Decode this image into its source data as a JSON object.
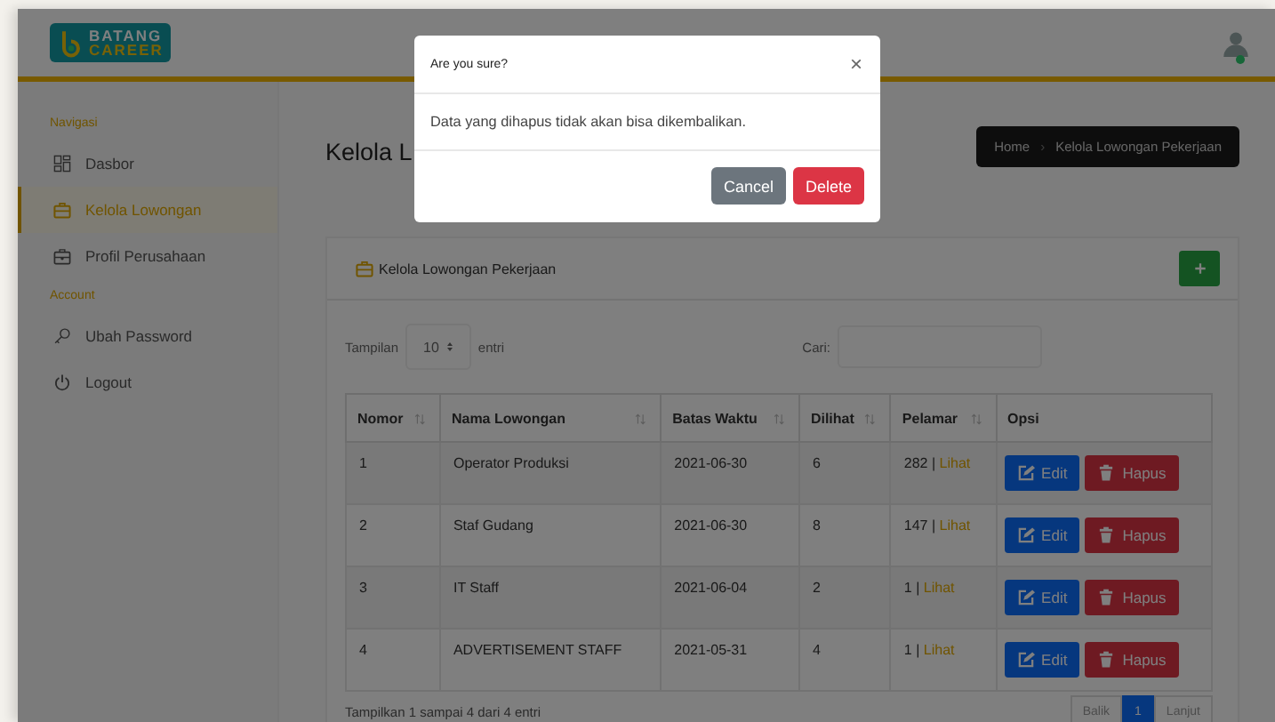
{
  "header": {
    "logo": {
      "line1": "BATANG",
      "line2": "CAREER"
    },
    "user": {
      "online": true
    }
  },
  "sidebar": {
    "sections": [
      {
        "heading": "Navigasi",
        "items": [
          {
            "label": "Dasbor",
            "selected": false
          },
          {
            "label": "Kelola Lowongan",
            "selected": true
          },
          {
            "label": "Profil Perusahaan",
            "selected": false
          }
        ]
      },
      {
        "heading": "Account",
        "items": [
          {
            "label": "Ubah Password",
            "selected": false
          },
          {
            "label": "Logout",
            "selected": false
          }
        ]
      }
    ]
  },
  "page_title": "Kelola L",
  "breadcrumb": {
    "items": [
      "Home",
      "Kelola Lowongan Pekerjaan"
    ],
    "separator": "›"
  },
  "card": {
    "title": "Kelola Lowongan Pekerjaan",
    "length_label": "Tampilan",
    "length_value": "10",
    "length_suffix": "entri",
    "search_label": "Cari:",
    "table": {
      "columns": [
        "Nomor",
        "Nama Lowongan",
        "Batas Waktu",
        "Dilihat",
        "Pelamar",
        "Opsi"
      ],
      "rows": [
        {
          "cells": [
            "1",
            "Operator Produksi",
            "2021-06-30",
            "6"
          ],
          "applicants": "282 |",
          "link": "Lihat",
          "actions": [
            "Edit",
            "Hapus"
          ]
        },
        {
          "cells": [
            "2",
            "Staf Gudang",
            "2021-06-30",
            "8"
          ],
          "applicants": "147 |",
          "link": "Lihat",
          "actions": [
            "Edit",
            "Hapus"
          ]
        },
        {
          "cells": [
            "3",
            "IT Staff",
            "2021-06-04",
            "2"
          ],
          "applicants": "1 |",
          "link": "Lihat",
          "actions": [
            "Edit",
            "Hapus"
          ]
        },
        {
          "cells": [
            "4",
            "ADVERTISEMENT STAFF",
            "2021-05-31",
            "4"
          ],
          "applicants": "1 |",
          "link": "Lihat",
          "actions": [
            "Edit",
            "Hapus"
          ]
        }
      ]
    },
    "info": "Tampilkan 1 sampai 4 dari 4 entri",
    "pagination": [
      {
        "label": "Balik",
        "selected": false
      },
      {
        "label": "1",
        "selected": true
      },
      {
        "label": "Lanjut",
        "selected": false
      }
    ]
  },
  "modal": {
    "title": "Are you sure?",
    "close": "×",
    "message": "Data yang dihapus tidak akan bisa dikembalikan.",
    "buttons": [
      {
        "label": "Cancel",
        "kind": "secondary"
      },
      {
        "label": "Delete",
        "kind": "danger"
      }
    ]
  }
}
